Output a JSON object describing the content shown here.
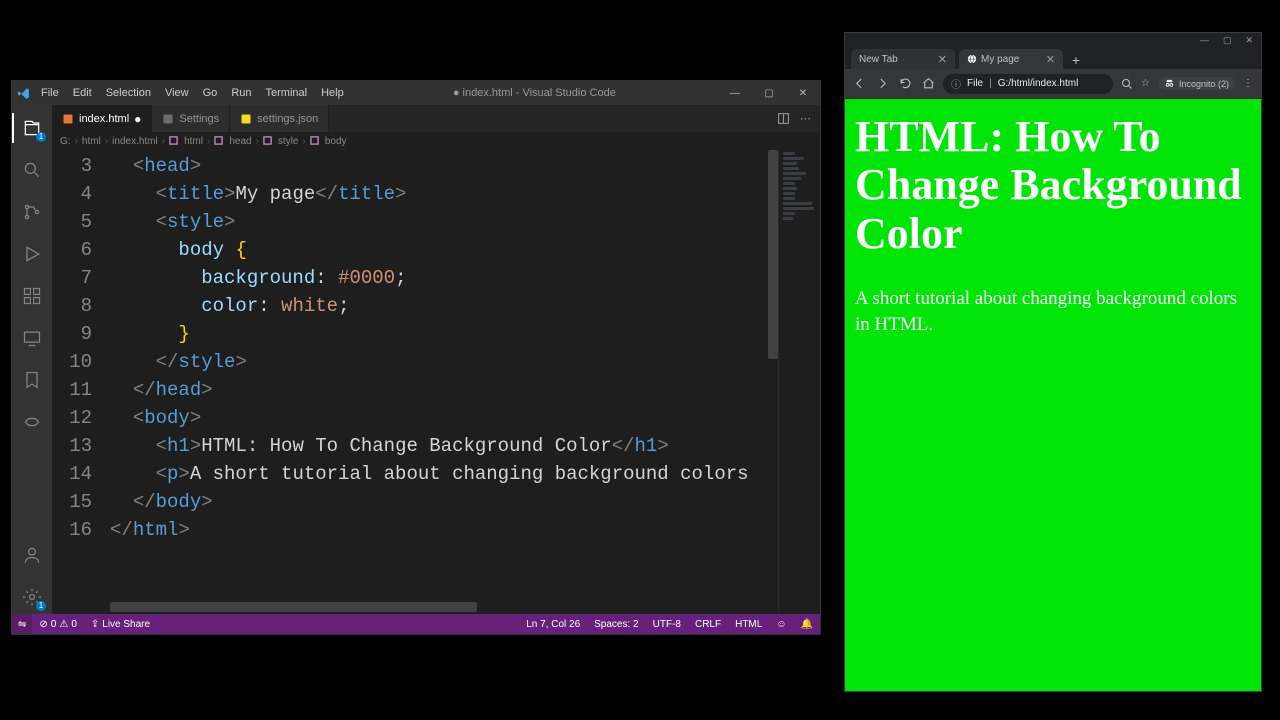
{
  "vscode": {
    "title": "● index.html - Visual Studio Code",
    "menu": [
      "File",
      "Edit",
      "Selection",
      "View",
      "Go",
      "Run",
      "Terminal",
      "Help"
    ],
    "tabs": [
      {
        "label": "index.html",
        "dirty": true,
        "active": true,
        "icon": "html"
      },
      {
        "label": "Settings",
        "dirty": false,
        "active": false,
        "icon": "gear"
      },
      {
        "label": "settings.json",
        "dirty": false,
        "active": false,
        "icon": "json"
      }
    ],
    "breadcrumbs": [
      "G:",
      "html",
      "index.html",
      "html",
      "head",
      "style",
      "body"
    ],
    "gutter_start": 3,
    "gutter_end": 16,
    "code_lines": [
      {
        "indent": 2,
        "parts": [
          {
            "c": "punct",
            "t": "<"
          },
          {
            "c": "tag",
            "t": "head"
          },
          {
            "c": "punct",
            "t": ">"
          }
        ]
      },
      {
        "indent": 4,
        "parts": [
          {
            "c": "punct",
            "t": "<"
          },
          {
            "c": "tag",
            "t": "title"
          },
          {
            "c": "punct",
            "t": ">"
          },
          {
            "c": "txt",
            "t": "My page"
          },
          {
            "c": "punct",
            "t": "</"
          },
          {
            "c": "tag",
            "t": "title"
          },
          {
            "c": "punct",
            "t": ">"
          }
        ]
      },
      {
        "indent": 4,
        "parts": [
          {
            "c": "punct",
            "t": "<"
          },
          {
            "c": "tag",
            "t": "style"
          },
          {
            "c": "punct",
            "t": ">"
          }
        ]
      },
      {
        "indent": 6,
        "parts": [
          {
            "c": "attr",
            "t": "body"
          },
          {
            "c": "txt",
            "t": " "
          },
          {
            "c": "brace",
            "t": "{"
          }
        ]
      },
      {
        "indent": 8,
        "parts": [
          {
            "c": "attr",
            "t": "background"
          },
          {
            "c": "txt",
            "t": ": "
          },
          {
            "c": "val",
            "t": "#0000"
          },
          {
            "c": "txt",
            "t": ";"
          }
        ]
      },
      {
        "indent": 8,
        "parts": [
          {
            "c": "attr",
            "t": "color"
          },
          {
            "c": "txt",
            "t": ": "
          },
          {
            "c": "val",
            "t": "white"
          },
          {
            "c": "txt",
            "t": ";"
          }
        ]
      },
      {
        "indent": 6,
        "parts": [
          {
            "c": "brace",
            "t": "}"
          }
        ]
      },
      {
        "indent": 4,
        "parts": [
          {
            "c": "punct",
            "t": "</"
          },
          {
            "c": "tag",
            "t": "style"
          },
          {
            "c": "punct",
            "t": ">"
          }
        ]
      },
      {
        "indent": 2,
        "parts": [
          {
            "c": "punct",
            "t": "</"
          },
          {
            "c": "tag",
            "t": "head"
          },
          {
            "c": "punct",
            "t": ">"
          }
        ]
      },
      {
        "indent": 2,
        "parts": [
          {
            "c": "punct",
            "t": "<"
          },
          {
            "c": "tag",
            "t": "body"
          },
          {
            "c": "punct",
            "t": ">"
          }
        ]
      },
      {
        "indent": 4,
        "parts": [
          {
            "c": "punct",
            "t": "<"
          },
          {
            "c": "tag",
            "t": "h1"
          },
          {
            "c": "punct",
            "t": ">"
          },
          {
            "c": "txt",
            "t": "HTML: How To Change Background Color"
          },
          {
            "c": "punct",
            "t": "</"
          },
          {
            "c": "tag",
            "t": "h1"
          },
          {
            "c": "punct",
            "t": ">"
          }
        ]
      },
      {
        "indent": 4,
        "parts": [
          {
            "c": "punct",
            "t": "<"
          },
          {
            "c": "tag",
            "t": "p"
          },
          {
            "c": "punct",
            "t": ">"
          },
          {
            "c": "txt",
            "t": "A short tutorial about changing background colors"
          }
        ]
      },
      {
        "indent": 2,
        "parts": [
          {
            "c": "punct",
            "t": "</"
          },
          {
            "c": "tag",
            "t": "body"
          },
          {
            "c": "punct",
            "t": ">"
          }
        ]
      },
      {
        "indent": 0,
        "parts": [
          {
            "c": "punct",
            "t": "</"
          },
          {
            "c": "tag",
            "t": "html"
          },
          {
            "c": "punct",
            "t": ">"
          }
        ]
      }
    ],
    "status": {
      "remote_icon": "⇄",
      "errors": "0",
      "warnings": "0",
      "live_share": "Live Share",
      "lncol": "Ln 7, Col 26",
      "spaces": "Spaces: 2",
      "encoding": "UTF-8",
      "eol": "CRLF",
      "lang": "HTML",
      "feedback": "☺",
      "bell": "🔔"
    },
    "activity_badges": {
      "explorer": "1",
      "settings": "1"
    }
  },
  "browser": {
    "win_controls": [
      "—",
      "▢",
      "✕"
    ],
    "tabs": [
      {
        "label": "New Tab",
        "active": false
      },
      {
        "label": "My page",
        "active": true
      }
    ],
    "address": {
      "scheme": "File",
      "path": "G:/html/index.html"
    },
    "incognito": "Incognito (2)",
    "page": {
      "h1": "HTML: How To Change Background Color",
      "p": "A short tutorial about changing background colors in HTML."
    }
  }
}
